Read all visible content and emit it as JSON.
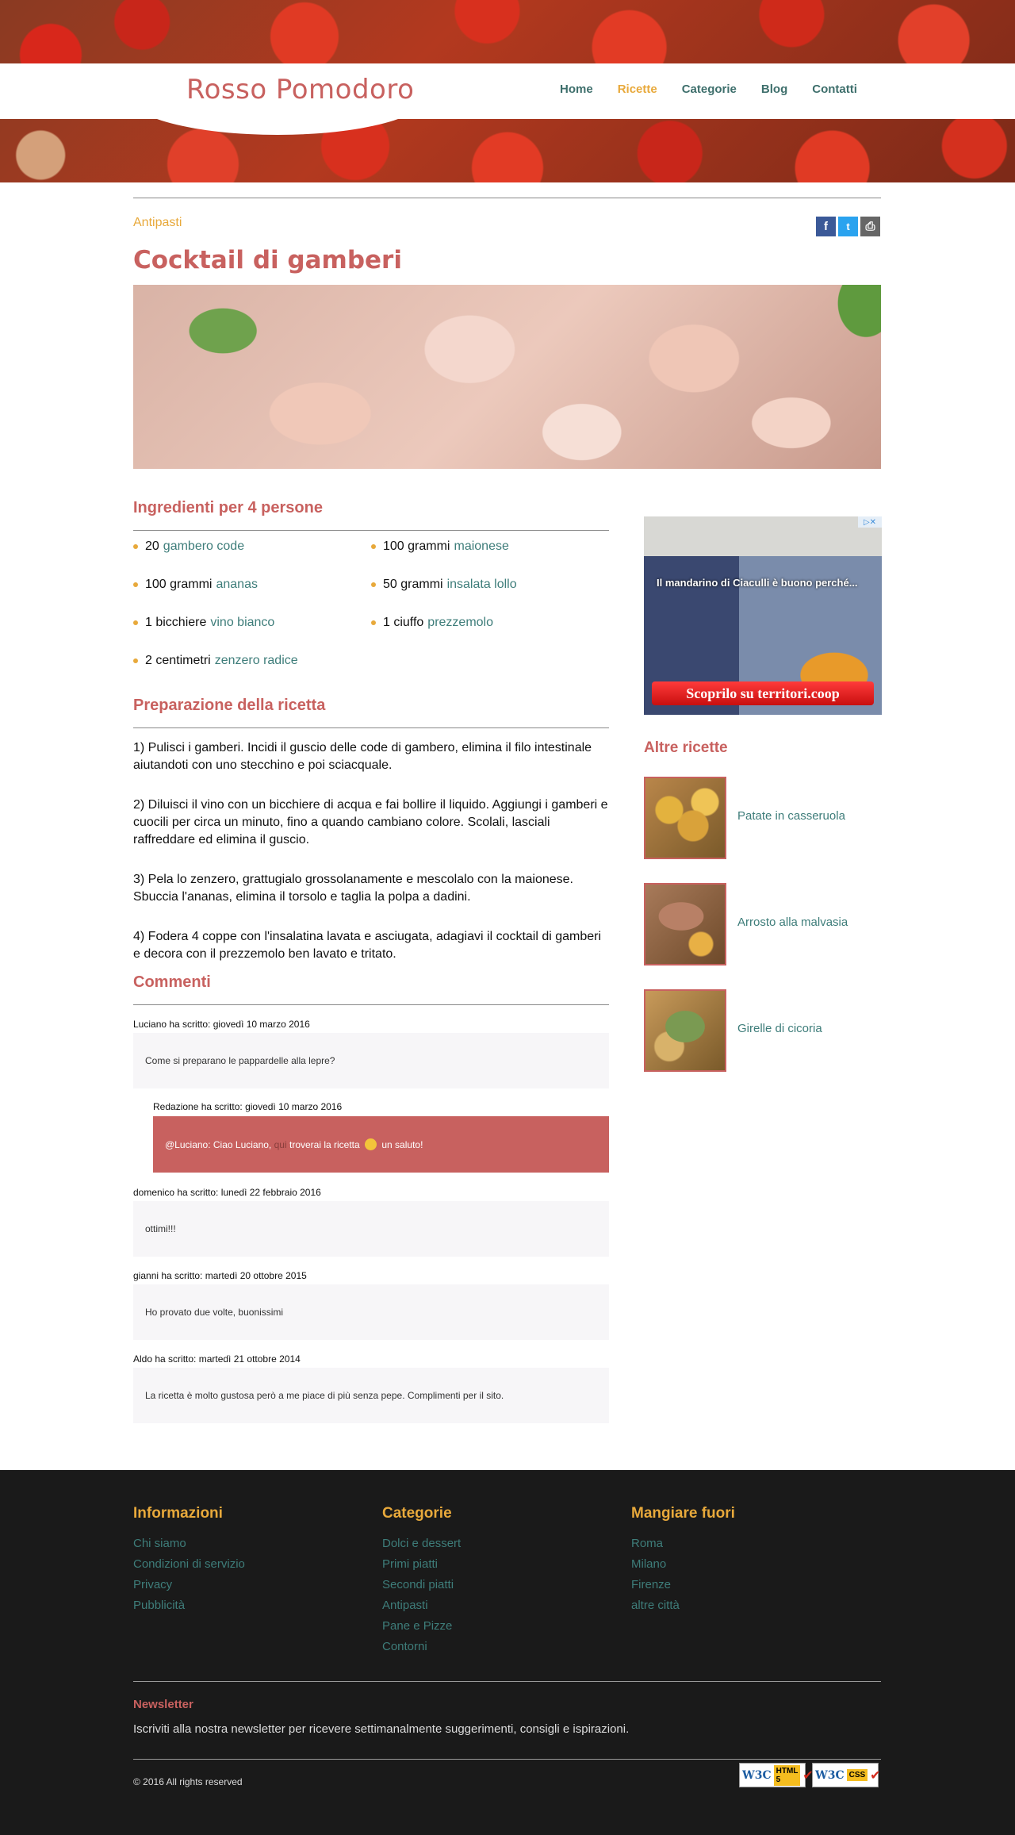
{
  "header": {
    "logo": "Rosso Pomodoro",
    "nav": [
      {
        "label": "Home",
        "active": false
      },
      {
        "label": "Ricette",
        "active": true
      },
      {
        "label": "Categorie",
        "active": false
      },
      {
        "label": "Blog",
        "active": false
      },
      {
        "label": "Contatti",
        "active": false
      }
    ]
  },
  "article": {
    "category": "Antipasti",
    "share": {
      "facebook": "f",
      "twitter": "t",
      "print": "⎙"
    },
    "title": "Cocktail di gamberi"
  },
  "ingredients": {
    "heading": "Ingredienti per 4 persone",
    "items": [
      {
        "qty": "20",
        "name": "gambero code"
      },
      {
        "qty": "100 grammi",
        "name": "maionese"
      },
      {
        "qty": "100 grammi",
        "name": "ananas"
      },
      {
        "qty": "50 grammi",
        "name": "insalata lollo"
      },
      {
        "qty": "1 bicchiere",
        "name": "vino bianco"
      },
      {
        "qty": "1 ciuffo",
        "name": "prezzemolo"
      },
      {
        "qty": "2 centimetri",
        "name": "zenzero radice"
      }
    ]
  },
  "preparation": {
    "heading": "Preparazione della ricetta",
    "steps": [
      "1) Pulisci i gamberi. Incidi il guscio delle code di gambero, elimina il filo intestinale aiutandoti con uno stecchino e poi sciacquale.",
      "2) Diluisci il vino con un bicchiere di acqua e fai bollire il liquido. Aggiungi i gamberi e cuocili per circa un minuto, fino a quando cambiano colore. Scolali, lasciali raffreddare ed elimina il guscio.",
      "3) Pela lo zenzero, grattugialo grossolanamente e mescolalo con la maionese. Sbuccia l'ananas, elimina il torsolo e taglia la polpa a dadini.",
      "4) Fodera 4 coppe con l'insalatina lavata e asciugata, adagiavi il cocktail di gamberi e decora con il prezzemolo ben lavato e tritato."
    ]
  },
  "comments": {
    "heading": "Commenti",
    "items": [
      {
        "author": "Luciano ha scritto: giovedì 10 marzo 2016",
        "text": "Come si preparano le pappardelle alla lepre?"
      },
      {
        "author": "Redazione ha scritto: giovedì 10 marzo 2016",
        "text_a": "@Luciano: Ciao Luciano,",
        "text_muted": "qui",
        "text_b": "troverai la ricetta",
        "text_c": "un saluto!"
      },
      {
        "author": "domenico ha scritto: lunedì 22 febbraio 2016",
        "text": "ottimi!!!"
      },
      {
        "author": "gianni ha scritto: martedì 20 ottobre 2015",
        "text": "Ho provato due volte, buonissimi"
      },
      {
        "author": "Aldo ha scritto: martedì 21 ottobre 2014",
        "text": "La ricetta è molto gustosa però a me piace di più senza pepe. Complimenti per il sito."
      }
    ]
  },
  "sidebar": {
    "ad": {
      "text": "Il mandarino di Ciaculli è buono perché...",
      "button": "Scoprilo su territori.coop",
      "badge": "▷✕"
    },
    "heading": "Altre ricette",
    "recipes": [
      {
        "label": "Patate in casseruola"
      },
      {
        "label": "Arrosto alla malvasia"
      },
      {
        "label": "Girelle di cicoria"
      }
    ]
  },
  "footer": {
    "col1": {
      "heading": "Informazioni",
      "links": [
        "Chi siamo",
        "Condizioni di servizio",
        "Privacy",
        "Pubblicità"
      ]
    },
    "col2": {
      "heading": "Categorie",
      "links": [
        "Dolci e dessert",
        "Primi piatti",
        "Secondi piatti",
        "Antipasti",
        "Pane e Pizze",
        "Contorni"
      ]
    },
    "col3": {
      "heading": "Mangiare fuori",
      "links": [
        "Roma",
        "Milano",
        "Firenze",
        "altre città"
      ]
    },
    "newsletter_heading": "Newsletter",
    "newsletter_text": "Iscriviti alla nostra newsletter per ricevere settimanalmente suggerimenti, consigli e ispirazioni.",
    "copyright": "© 2016 All rights reserved",
    "badges": [
      {
        "w": "W3C",
        "tag": "HTML 5"
      },
      {
        "w": "W3C",
        "tag": "CSS"
      }
    ]
  }
}
